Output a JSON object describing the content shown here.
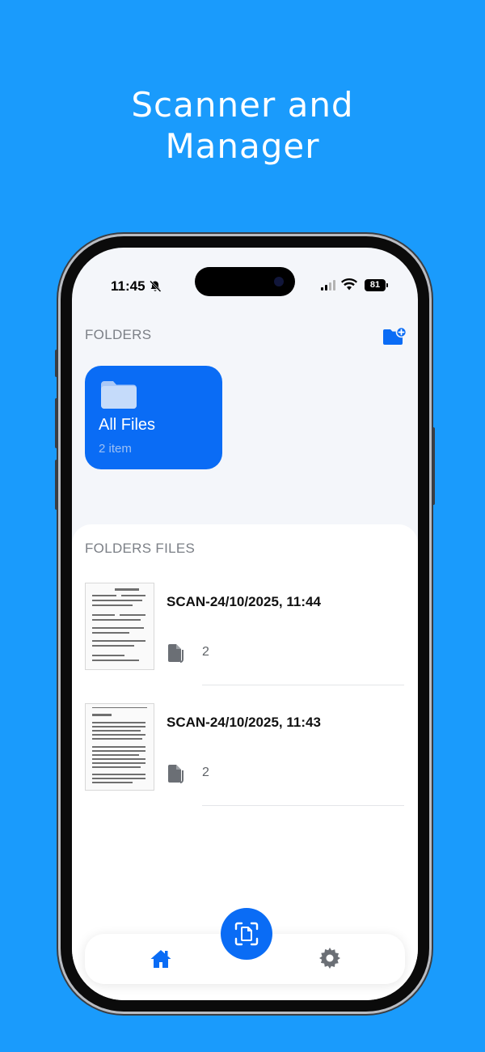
{
  "headline": {
    "line1": "Scanner and",
    "line2": "Manager"
  },
  "status_bar": {
    "time": "11:45",
    "battery": "81"
  },
  "folders": {
    "section_title": "FOLDERS",
    "items": [
      {
        "name": "All Files",
        "count": "2 item"
      }
    ]
  },
  "files": {
    "section_title": "FOLDERS FILES",
    "items": [
      {
        "title": "SCAN-24/10/2025, 11:44",
        "pages": "2"
      },
      {
        "title": "SCAN-24/10/2025, 11:43",
        "pages": "2"
      }
    ]
  },
  "colors": {
    "background": "#1a9bfc",
    "accent": "#0a6cf5"
  },
  "icons": {
    "add_folder": "folder-plus-icon",
    "folder": "folder-icon",
    "pages": "document-copy-icon",
    "scan": "document-scan-icon",
    "home": "home-icon",
    "settings": "gear-icon"
  }
}
